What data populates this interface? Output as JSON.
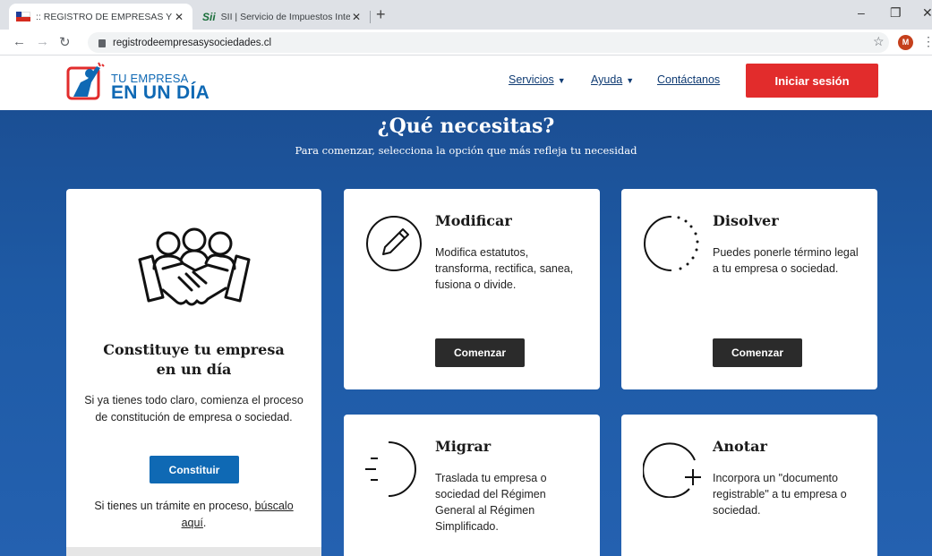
{
  "browser": {
    "tabs": [
      {
        "title": ":: REGISTRO DE EMPRESAS Y SOCIEDADES",
        "close": "✕"
      },
      {
        "title": "SII | Servicio de Impuestos Internos",
        "close": "✕",
        "favicon_text": "Sii"
      }
    ],
    "new_tab": "+",
    "window_controls": {
      "minimize": "–",
      "restore": "❐",
      "close": "✕"
    },
    "url": "registrodeempresasysociedades.cl",
    "profile_initial": "M"
  },
  "header": {
    "logo_line1": "TU EMPRESA",
    "logo_line2": "EN UN DÍA",
    "nav": {
      "servicios": "Servicios",
      "ayuda": "Ayuda",
      "contacto": "Contáctanos"
    },
    "login": "Iniciar sesión"
  },
  "hero": {
    "title": "¿Qué necesitas?",
    "subtitle": "Para comenzar, selecciona la opción que más refleja tu necesidad"
  },
  "main_card": {
    "title_line1": "Constituye tu empresa",
    "title_line2": "en un día",
    "description": "Si ya tienes todo claro, comienza el proceso de constitución de empresa o sociedad.",
    "button": "Constituir",
    "pending_text": "Si tienes un trámite en proceso, ",
    "pending_link": "búscalo aquí",
    "pending_end": "."
  },
  "cards": {
    "modificar": {
      "title": "Modificar",
      "description": "Modifica estatutos, transforma, rectifica, sanea, fusiona o divide.",
      "button": "Comenzar"
    },
    "disolver": {
      "title": "Disolver",
      "description": "Puedes ponerle término legal a tu empresa o sociedad.",
      "button": "Comenzar"
    },
    "migrar": {
      "title": "Migrar",
      "description": "Traslada tu empresa o sociedad del Régimen General al Régimen Simplificado."
    },
    "anotar": {
      "title": "Anotar",
      "description": "Incorpora un \"documento registrable\" a tu empresa o sociedad."
    }
  },
  "colors": {
    "brand_blue": "#0f69b4",
    "login_red": "#e22c2c",
    "hero_blue": "#1e5aa5"
  }
}
